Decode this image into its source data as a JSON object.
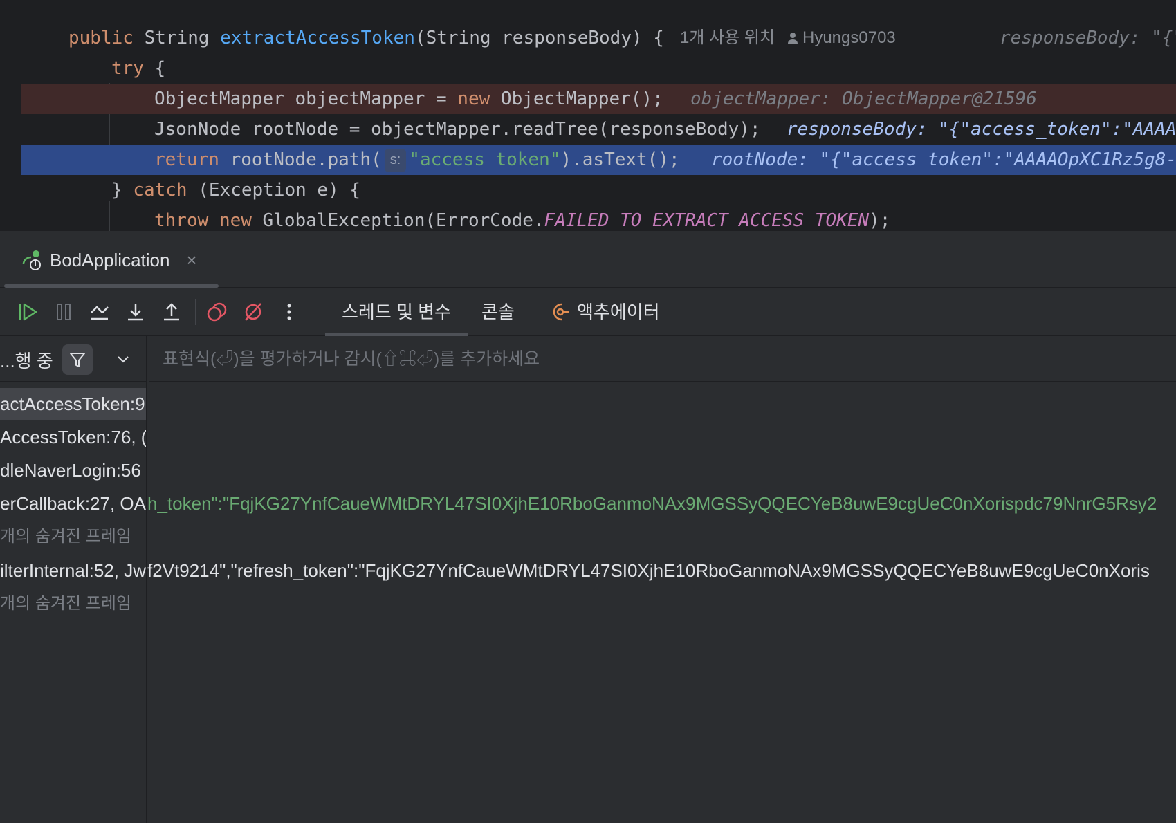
{
  "editor": {
    "line1": {
      "kw_public": "public",
      "type": "String",
      "method": "extractAccessToken",
      "params": "(String responseBody) {",
      "usages": "1개 사용 위치",
      "author": "Hyungs0703",
      "inline_hint": "responseBody: \"{\""
    },
    "line2": {
      "kw_try": "try",
      "brace": "{"
    },
    "line3": {
      "code_a": "ObjectMapper objectMapper = ",
      "kw_new": "new",
      "code_b": " ObjectMapper();",
      "inline_hint": "objectMapper: ObjectMapper@21596"
    },
    "line4": {
      "code": "JsonNode rootNode = objectMapper.readTree(responseBody);",
      "inline_hint": "responseBody: \"{\"access_token\":\"AAAA"
    },
    "line5": {
      "kw_return": "return",
      "code_a": " rootNode.path(",
      "param_chip": "s:",
      "string": "\"access_token\"",
      "code_b": ").asText();",
      "inline_hint": "rootNode: \"{\"access_token\":\"AAAAOpXC1Rz5g8-"
    },
    "line6": {
      "brace": "} ",
      "kw_catch": "catch",
      "code": " (Exception e) {"
    },
    "line7": {
      "kw_throw": "throw",
      "kw_new": "new",
      "code_a": " GlobalException(ErrorCode.",
      "const": "FAILED_TO_EXTRACT_ACCESS_TOKEN",
      "code_b": ");"
    }
  },
  "tool_window": {
    "run_tab_label": "BodApplication",
    "run_tab_close": "×",
    "toolbar_icons": [
      "resume-icon",
      "pause-icon",
      "step-over-icon",
      "step-into-icon",
      "step-out-icon",
      "view-breakpoints-icon",
      "mute-breakpoints-icon",
      "more-icon"
    ],
    "tabs": [
      "스레드 및 변수",
      "콘솔",
      "액추에이터"
    ],
    "active_tab": "스레드 및 변수"
  },
  "frames": {
    "status": "...행 중",
    "items": [
      {
        "label": "actAccessToken:9",
        "selected": true
      },
      {
        "label": "AccessToken:76, ("
      },
      {
        "label": "dleNaverLogin:56"
      },
      {
        "label": "erCallback:27, OA"
      },
      {
        "label": "개의 숨겨진 프레임",
        "hidden": true
      },
      {
        "label": "ilterInternal:52, Jw"
      },
      {
        "label": "개의 숨겨진 프레임",
        "hidden": true
      }
    ]
  },
  "variables": {
    "eval_placeholder": "표현식(⏎)을 평가하거나 감시(⇧⌘⏎)를 추가하세요",
    "overlay_green": "h_token\":\"FqjKG27YnfCaueWMtDRYL47SI0XjhE10RboGanmoNAx9MGSSyQQECYeB8uwE9cgUeC0nXorispdc79NnrG5Rsy2",
    "overlay_white": "f2Vt9214\",\"refresh_token\":\"FqjKG27YnfCaueWMtDRYL47SI0XjhE10RboGanmoNAx9MGSSyQQECYeB8uwE9cgUeC0nXoris"
  },
  "colors": {
    "editor_bg": "#1e1f22",
    "panel_bg": "#2b2d30",
    "breakpoint_line": "#402929",
    "current_line": "#2e4a8a",
    "keyword": "#cf8e6d",
    "method": "#56a8f5",
    "string": "#6aab73",
    "constant": "#c77dbb"
  }
}
